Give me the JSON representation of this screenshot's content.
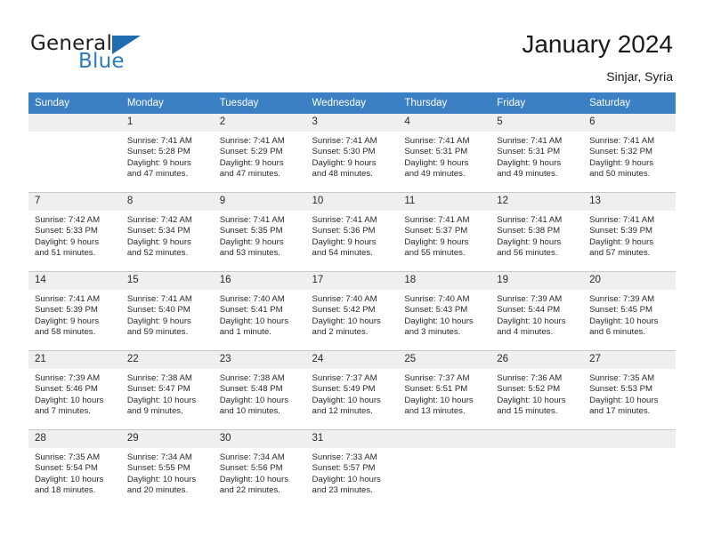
{
  "brand": {
    "name_top": "General",
    "name_bottom": "Blue",
    "accent_color": "#2b7cc2",
    "triangle_icon": "triangle-icon"
  },
  "header": {
    "title": "January 2024",
    "location": "Sinjar, Syria"
  },
  "calendar": {
    "header_bg": "#3b7fc4",
    "date_band_bg": "#efefef",
    "weekdays": [
      "Sunday",
      "Monday",
      "Tuesday",
      "Wednesday",
      "Thursday",
      "Friday",
      "Saturday"
    ],
    "weeks": [
      [
        {
          "day": "",
          "sunrise": "",
          "sunset": "",
          "daylight_1": "",
          "daylight_2": ""
        },
        {
          "day": "1",
          "sunrise": "Sunrise: 7:41 AM",
          "sunset": "Sunset: 5:28 PM",
          "daylight_1": "Daylight: 9 hours",
          "daylight_2": "and 47 minutes."
        },
        {
          "day": "2",
          "sunrise": "Sunrise: 7:41 AM",
          "sunset": "Sunset: 5:29 PM",
          "daylight_1": "Daylight: 9 hours",
          "daylight_2": "and 47 minutes."
        },
        {
          "day": "3",
          "sunrise": "Sunrise: 7:41 AM",
          "sunset": "Sunset: 5:30 PM",
          "daylight_1": "Daylight: 9 hours",
          "daylight_2": "and 48 minutes."
        },
        {
          "day": "4",
          "sunrise": "Sunrise: 7:41 AM",
          "sunset": "Sunset: 5:31 PM",
          "daylight_1": "Daylight: 9 hours",
          "daylight_2": "and 49 minutes."
        },
        {
          "day": "5",
          "sunrise": "Sunrise: 7:41 AM",
          "sunset": "Sunset: 5:31 PM",
          "daylight_1": "Daylight: 9 hours",
          "daylight_2": "and 49 minutes."
        },
        {
          "day": "6",
          "sunrise": "Sunrise: 7:41 AM",
          "sunset": "Sunset: 5:32 PM",
          "daylight_1": "Daylight: 9 hours",
          "daylight_2": "and 50 minutes."
        }
      ],
      [
        {
          "day": "7",
          "sunrise": "Sunrise: 7:42 AM",
          "sunset": "Sunset: 5:33 PM",
          "daylight_1": "Daylight: 9 hours",
          "daylight_2": "and 51 minutes."
        },
        {
          "day": "8",
          "sunrise": "Sunrise: 7:42 AM",
          "sunset": "Sunset: 5:34 PM",
          "daylight_1": "Daylight: 9 hours",
          "daylight_2": "and 52 minutes."
        },
        {
          "day": "9",
          "sunrise": "Sunrise: 7:41 AM",
          "sunset": "Sunset: 5:35 PM",
          "daylight_1": "Daylight: 9 hours",
          "daylight_2": "and 53 minutes."
        },
        {
          "day": "10",
          "sunrise": "Sunrise: 7:41 AM",
          "sunset": "Sunset: 5:36 PM",
          "daylight_1": "Daylight: 9 hours",
          "daylight_2": "and 54 minutes."
        },
        {
          "day": "11",
          "sunrise": "Sunrise: 7:41 AM",
          "sunset": "Sunset: 5:37 PM",
          "daylight_1": "Daylight: 9 hours",
          "daylight_2": "and 55 minutes."
        },
        {
          "day": "12",
          "sunrise": "Sunrise: 7:41 AM",
          "sunset": "Sunset: 5:38 PM",
          "daylight_1": "Daylight: 9 hours",
          "daylight_2": "and 56 minutes."
        },
        {
          "day": "13",
          "sunrise": "Sunrise: 7:41 AM",
          "sunset": "Sunset: 5:39 PM",
          "daylight_1": "Daylight: 9 hours",
          "daylight_2": "and 57 minutes."
        }
      ],
      [
        {
          "day": "14",
          "sunrise": "Sunrise: 7:41 AM",
          "sunset": "Sunset: 5:39 PM",
          "daylight_1": "Daylight: 9 hours",
          "daylight_2": "and 58 minutes."
        },
        {
          "day": "15",
          "sunrise": "Sunrise: 7:41 AM",
          "sunset": "Sunset: 5:40 PM",
          "daylight_1": "Daylight: 9 hours",
          "daylight_2": "and 59 minutes."
        },
        {
          "day": "16",
          "sunrise": "Sunrise: 7:40 AM",
          "sunset": "Sunset: 5:41 PM",
          "daylight_1": "Daylight: 10 hours",
          "daylight_2": "and 1 minute."
        },
        {
          "day": "17",
          "sunrise": "Sunrise: 7:40 AM",
          "sunset": "Sunset: 5:42 PM",
          "daylight_1": "Daylight: 10 hours",
          "daylight_2": "and 2 minutes."
        },
        {
          "day": "18",
          "sunrise": "Sunrise: 7:40 AM",
          "sunset": "Sunset: 5:43 PM",
          "daylight_1": "Daylight: 10 hours",
          "daylight_2": "and 3 minutes."
        },
        {
          "day": "19",
          "sunrise": "Sunrise: 7:39 AM",
          "sunset": "Sunset: 5:44 PM",
          "daylight_1": "Daylight: 10 hours",
          "daylight_2": "and 4 minutes."
        },
        {
          "day": "20",
          "sunrise": "Sunrise: 7:39 AM",
          "sunset": "Sunset: 5:45 PM",
          "daylight_1": "Daylight: 10 hours",
          "daylight_2": "and 6 minutes."
        }
      ],
      [
        {
          "day": "21",
          "sunrise": "Sunrise: 7:39 AM",
          "sunset": "Sunset: 5:46 PM",
          "daylight_1": "Daylight: 10 hours",
          "daylight_2": "and 7 minutes."
        },
        {
          "day": "22",
          "sunrise": "Sunrise: 7:38 AM",
          "sunset": "Sunset: 5:47 PM",
          "daylight_1": "Daylight: 10 hours",
          "daylight_2": "and 9 minutes."
        },
        {
          "day": "23",
          "sunrise": "Sunrise: 7:38 AM",
          "sunset": "Sunset: 5:48 PM",
          "daylight_1": "Daylight: 10 hours",
          "daylight_2": "and 10 minutes."
        },
        {
          "day": "24",
          "sunrise": "Sunrise: 7:37 AM",
          "sunset": "Sunset: 5:49 PM",
          "daylight_1": "Daylight: 10 hours",
          "daylight_2": "and 12 minutes."
        },
        {
          "day": "25",
          "sunrise": "Sunrise: 7:37 AM",
          "sunset": "Sunset: 5:51 PM",
          "daylight_1": "Daylight: 10 hours",
          "daylight_2": "and 13 minutes."
        },
        {
          "day": "26",
          "sunrise": "Sunrise: 7:36 AM",
          "sunset": "Sunset: 5:52 PM",
          "daylight_1": "Daylight: 10 hours",
          "daylight_2": "and 15 minutes."
        },
        {
          "day": "27",
          "sunrise": "Sunrise: 7:35 AM",
          "sunset": "Sunset: 5:53 PM",
          "daylight_1": "Daylight: 10 hours",
          "daylight_2": "and 17 minutes."
        }
      ],
      [
        {
          "day": "28",
          "sunrise": "Sunrise: 7:35 AM",
          "sunset": "Sunset: 5:54 PM",
          "daylight_1": "Daylight: 10 hours",
          "daylight_2": "and 18 minutes."
        },
        {
          "day": "29",
          "sunrise": "Sunrise: 7:34 AM",
          "sunset": "Sunset: 5:55 PM",
          "daylight_1": "Daylight: 10 hours",
          "daylight_2": "and 20 minutes."
        },
        {
          "day": "30",
          "sunrise": "Sunrise: 7:34 AM",
          "sunset": "Sunset: 5:56 PM",
          "daylight_1": "Daylight: 10 hours",
          "daylight_2": "and 22 minutes."
        },
        {
          "day": "31",
          "sunrise": "Sunrise: 7:33 AM",
          "sunset": "Sunset: 5:57 PM",
          "daylight_1": "Daylight: 10 hours",
          "daylight_2": "and 23 minutes."
        },
        {
          "day": "",
          "sunrise": "",
          "sunset": "",
          "daylight_1": "",
          "daylight_2": ""
        },
        {
          "day": "",
          "sunrise": "",
          "sunset": "",
          "daylight_1": "",
          "daylight_2": ""
        },
        {
          "day": "",
          "sunrise": "",
          "sunset": "",
          "daylight_1": "",
          "daylight_2": ""
        }
      ]
    ]
  }
}
